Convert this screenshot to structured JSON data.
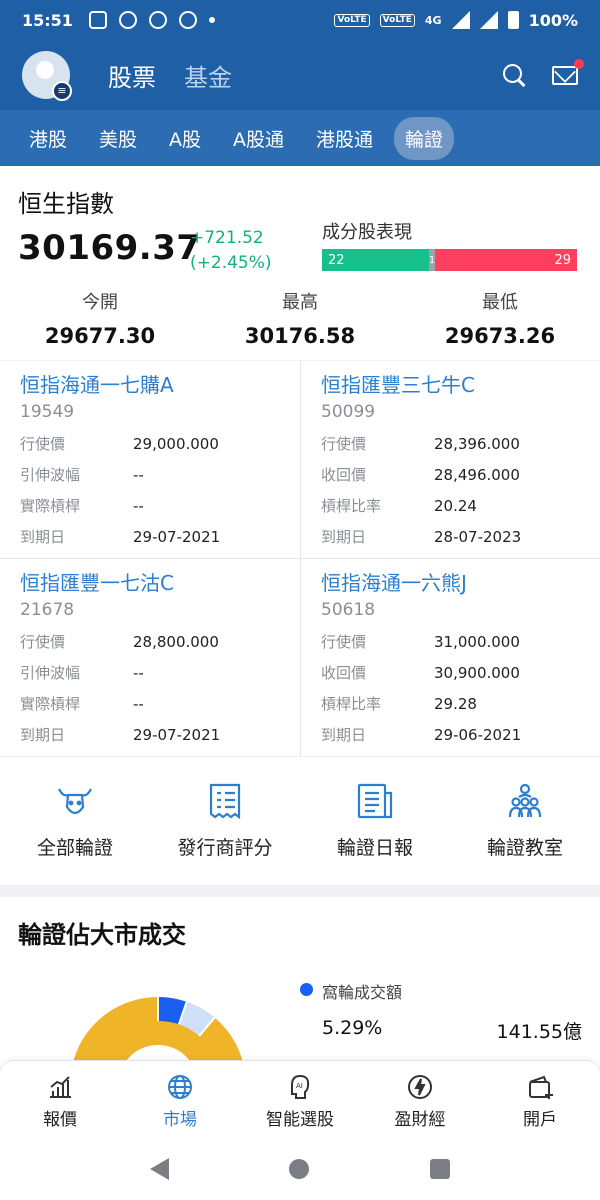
{
  "status_bar": {
    "time": "15:51",
    "network": "4G",
    "battery": "100%",
    "volte_tag": "VoLTE"
  },
  "header": {
    "tabs": [
      {
        "label": "股票",
        "active": true
      },
      {
        "label": "基金",
        "active": false
      }
    ]
  },
  "sub_tabs": [
    {
      "label": "港股",
      "active": false
    },
    {
      "label": "美股",
      "active": false
    },
    {
      "label": "A股",
      "active": false
    },
    {
      "label": "A股通",
      "active": false
    },
    {
      "label": "港股通",
      "active": false
    },
    {
      "label": "輪證",
      "active": true
    }
  ],
  "index": {
    "name": "恒生指數",
    "price": "30169.37",
    "change": "+721.52",
    "change_pct": "(+2.45%)",
    "components_label": "成分股表現",
    "components": {
      "up": 22,
      "flat": 1,
      "down": 29
    },
    "stats": [
      {
        "label": "今開",
        "value": "29677.30"
      },
      {
        "label": "最高",
        "value": "30176.58"
      },
      {
        "label": "最低",
        "value": "29673.26"
      }
    ]
  },
  "warrants": [
    {
      "name": "恒指海通一七購A",
      "code": "19549",
      "rows": [
        {
          "k": "行使價",
          "v": "29,000.000"
        },
        {
          "k": "引伸波幅",
          "v": "--"
        },
        {
          "k": "實際槓桿",
          "v": "--"
        },
        {
          "k": "到期日",
          "v": "29-07-2021"
        }
      ]
    },
    {
      "name": "恒指匯豐三七牛C",
      "code": "50099",
      "rows": [
        {
          "k": "行使價",
          "v": "28,396.000"
        },
        {
          "k": "收回價",
          "v": "28,496.000"
        },
        {
          "k": "槓桿比率",
          "v": "20.24"
        },
        {
          "k": "到期日",
          "v": "28-07-2023"
        }
      ]
    },
    {
      "name": "恒指匯豐一七沽C",
      "code": "21678",
      "rows": [
        {
          "k": "行使價",
          "v": "28,800.000"
        },
        {
          "k": "引伸波幅",
          "v": "--"
        },
        {
          "k": "實際槓桿",
          "v": "--"
        },
        {
          "k": "到期日",
          "v": "29-07-2021"
        }
      ]
    },
    {
      "name": "恒指海通一六熊J",
      "code": "50618",
      "rows": [
        {
          "k": "行使價",
          "v": "31,000.000"
        },
        {
          "k": "收回價",
          "v": "30,900.000"
        },
        {
          "k": "槓桿比率",
          "v": "29.28"
        },
        {
          "k": "到期日",
          "v": "29-06-2021"
        }
      ]
    }
  ],
  "actions": [
    {
      "label": "全部輪證",
      "icon": "bull-icon"
    },
    {
      "label": "發行商評分",
      "icon": "rating-icon"
    },
    {
      "label": "輪證日報",
      "icon": "report-icon"
    },
    {
      "label": "輪證教室",
      "icon": "classroom-icon"
    }
  ],
  "market_share": {
    "title": "輪證佔大市成交",
    "legend": "窩輪成交額",
    "pct": "5.29%",
    "amount": "141.55億"
  },
  "bottom_nav": [
    {
      "label": "報價",
      "icon": "chart-icon",
      "active": false
    },
    {
      "label": "市場",
      "icon": "globe-icon",
      "active": true
    },
    {
      "label": "智能選股",
      "icon": "ai-icon",
      "active": false
    },
    {
      "label": "盈財經",
      "icon": "lightning-icon",
      "active": false
    },
    {
      "label": "開戶",
      "icon": "wallet-icon",
      "active": false
    }
  ],
  "colors": {
    "header_bg": "#1f5fa6",
    "accent_blue": "#2c7fd0",
    "up_green": "#16c08a",
    "down_red": "#ff3f5e",
    "donut_yellow": "#f0b429",
    "donut_blue": "#1a5ff0",
    "donut_light": "#cfe0fb"
  }
}
